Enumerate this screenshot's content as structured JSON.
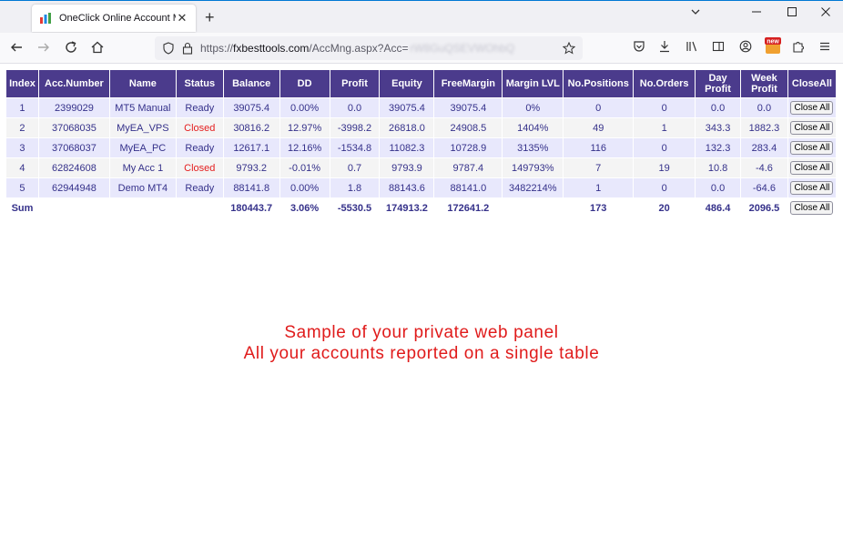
{
  "browser": {
    "tab_title": "OneClick Online Account Mana",
    "tab_close": "✕",
    "new_tab": "+",
    "url_prefix": "https://",
    "url_host": "fxbesttools.com",
    "url_path": "/AccMng.aspx?Acc=",
    "url_obscured": "rW8GuQSEVWOhbQ",
    "new_badge": "new"
  },
  "table": {
    "headers": [
      "Index",
      "Acc.Number",
      "Name",
      "Status",
      "Balance",
      "DD",
      "Profit",
      "Equity",
      "FreeMargin",
      "Margin LVL",
      "No.Positions",
      "No.Orders",
      "Day Profit",
      "Week Profit",
      "CloseAll"
    ],
    "button_label": "Close All",
    "rows": [
      {
        "index": "1",
        "acc": "2399029",
        "name": "MT5 Manual",
        "status": "Ready",
        "balance": "39075.4",
        "dd": "0.00%",
        "profit": "0.0",
        "equity": "39075.4",
        "free": "39075.4",
        "mlvl": "0%",
        "pos": "0",
        "orders": "0",
        "day": "0.0",
        "week": "0.0"
      },
      {
        "index": "2",
        "acc": "37068035",
        "name": "MyEA_VPS",
        "status": "Closed",
        "balance": "30816.2",
        "dd": "12.97%",
        "profit": "-3998.2",
        "equity": "26818.0",
        "free": "24908.5",
        "mlvl": "1404%",
        "pos": "49",
        "orders": "1",
        "day": "343.3",
        "week": "1882.3"
      },
      {
        "index": "3",
        "acc": "37068037",
        "name": "MyEA_PC",
        "status": "Ready",
        "balance": "12617.1",
        "dd": "12.16%",
        "profit": "-1534.8",
        "equity": "11082.3",
        "free": "10728.9",
        "mlvl": "3135%",
        "pos": "116",
        "orders": "0",
        "day": "132.3",
        "week": "283.4"
      },
      {
        "index": "4",
        "acc": "62824608",
        "name": "My Acc 1",
        "status": "Closed",
        "balance": "9793.2",
        "dd": "-0.01%",
        "profit": "0.7",
        "equity": "9793.9",
        "free": "9787.4",
        "mlvl": "149793%",
        "pos": "7",
        "orders": "19",
        "day": "10.8",
        "week": "-4.6"
      },
      {
        "index": "5",
        "acc": "62944948",
        "name": "Demo MT4",
        "status": "Ready",
        "balance": "88141.8",
        "dd": "0.00%",
        "profit": "1.8",
        "equity": "88143.6",
        "free": "88141.0",
        "mlvl": "3482214%",
        "pos": "1",
        "orders": "0",
        "day": "0.0",
        "week": "-64.6"
      }
    ],
    "sum": {
      "label": "Sum",
      "balance": "180443.7",
      "dd": "3.06%",
      "profit": "-5530.5",
      "equity": "174913.2",
      "free": "172641.2",
      "pos": "173",
      "orders": "20",
      "day": "486.4",
      "week": "2096.5"
    }
  },
  "caption": {
    "line1": "Sample of your private web panel",
    "line2": "All your accounts reported on a single table"
  },
  "colors": {
    "header_bg": "#4b3b8c",
    "closed_status": "#e41e1e",
    "row_odd": "#e8e8fc",
    "row_even": "#f4f4f4",
    "caption": "#e01b1b"
  }
}
